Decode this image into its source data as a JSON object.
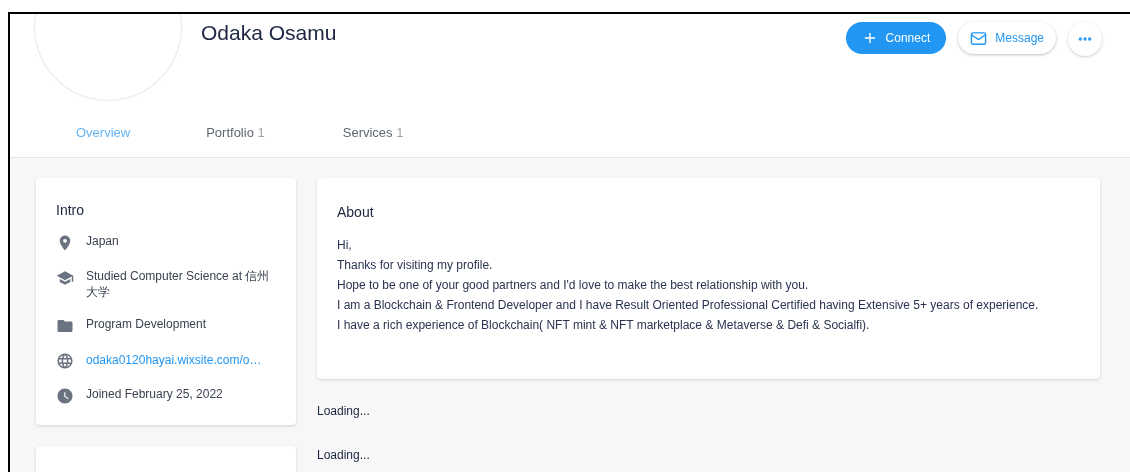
{
  "profile": {
    "name": "Odaka Osamu"
  },
  "actions": [
    {
      "kind": "connect",
      "label": "Connect"
    },
    {
      "kind": "message",
      "label": "Message"
    },
    {
      "kind": "more"
    }
  ],
  "tabs": [
    {
      "label": "Overview",
      "selected": true
    },
    {
      "label": "Portfolio",
      "count": "1",
      "selected": false
    },
    {
      "label": "Services",
      "count": "1",
      "selected": false
    }
  ],
  "intro": {
    "title": "Intro",
    "items": [
      {
        "kind": "location",
        "text": "Japan"
      },
      {
        "kind": "education",
        "text": "Studied Computer Science at 信州大学"
      },
      {
        "kind": "work",
        "text": "Program Development"
      },
      {
        "kind": "website",
        "text": "odaka0120hayai.wixsite.com/o…"
      },
      {
        "kind": "joined",
        "text": "Joined February 25, 2022"
      }
    ]
  },
  "about": {
    "title": "About",
    "lines": [
      "Hi,",
      "Thanks for visiting my profile.",
      "Hope to be one of your good partners and I'd love to make the best relationship with you.",
      "I am a Blockchain & Frontend Developer and I have Result Oriented Professional Certified having Extensive 5+ years of experience.",
      "I have a rich experience of Blockchain( NFT mint & NFT marketplace & Metaverse & Defi & Socialfi)."
    ]
  },
  "loading": [
    "Loading...",
    "Loading..."
  ]
}
